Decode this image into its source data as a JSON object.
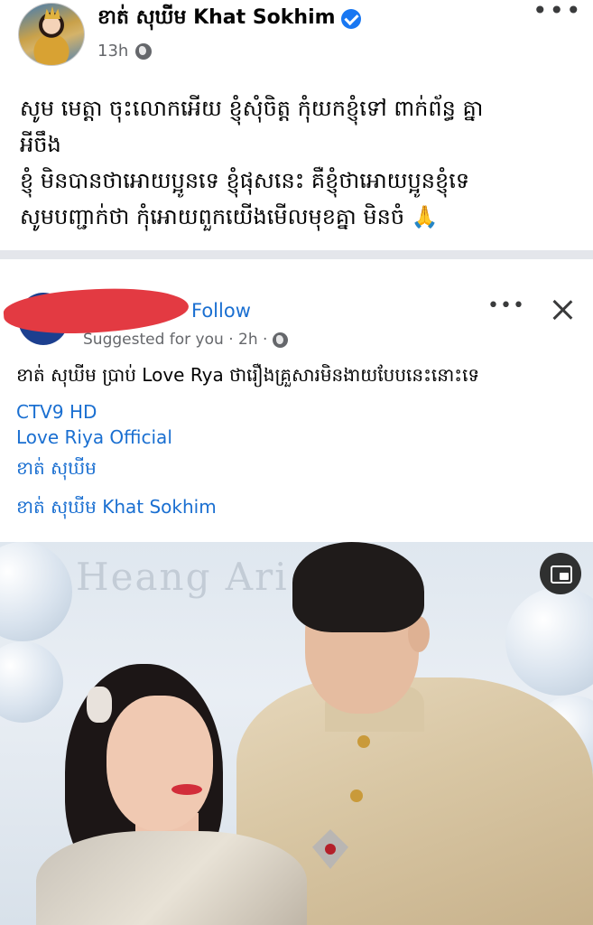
{
  "post": {
    "author": "ខាត់ សុឃីម Khat Sokhim",
    "time": "13h",
    "more_icon": "more-horizontal-icon",
    "lines": [
      "សូម មេត្តា ចុះលោកអើយ ខ្ញុំសុំចិត្ត កុំយកខ្ញុំទៅ ពាក់ព័ន្ធ គ្នា",
      "អីចឹង",
      "ខ្ញុំ មិនបានថាអោយប្អូនទេ ខ្ញុំផុសនេះ គឺខ្ញុំថាអោយប្អូនខ្ញុំទេ",
      "សូមបញ្ជាក់ថា កុំអោយពួកយើងមើលមុខគ្នា មិនចំ 🙏"
    ]
  },
  "shared": {
    "follow_label": "Follow",
    "suggested": "Suggested for you · 2h ·",
    "title": "ខាត់ សុឃីម ប្រាប់ Love Rya ថារឿងគ្រួសារមិនងាយបែបនេះនោះទេ",
    "tags": [
      "CTV9 HD",
      "Love Riya Official",
      "ខាត់ សុឃីម",
      "ខាត់ សុឃីម Khat Sokhim"
    ],
    "photo_backdrop_text": "Heang Ari     yuk"
  },
  "colors": {
    "link_blue": "#1a6fd1",
    "verified_blue": "#1877f2",
    "meta_gray": "#65676b",
    "divider": "#e4e6eb"
  }
}
